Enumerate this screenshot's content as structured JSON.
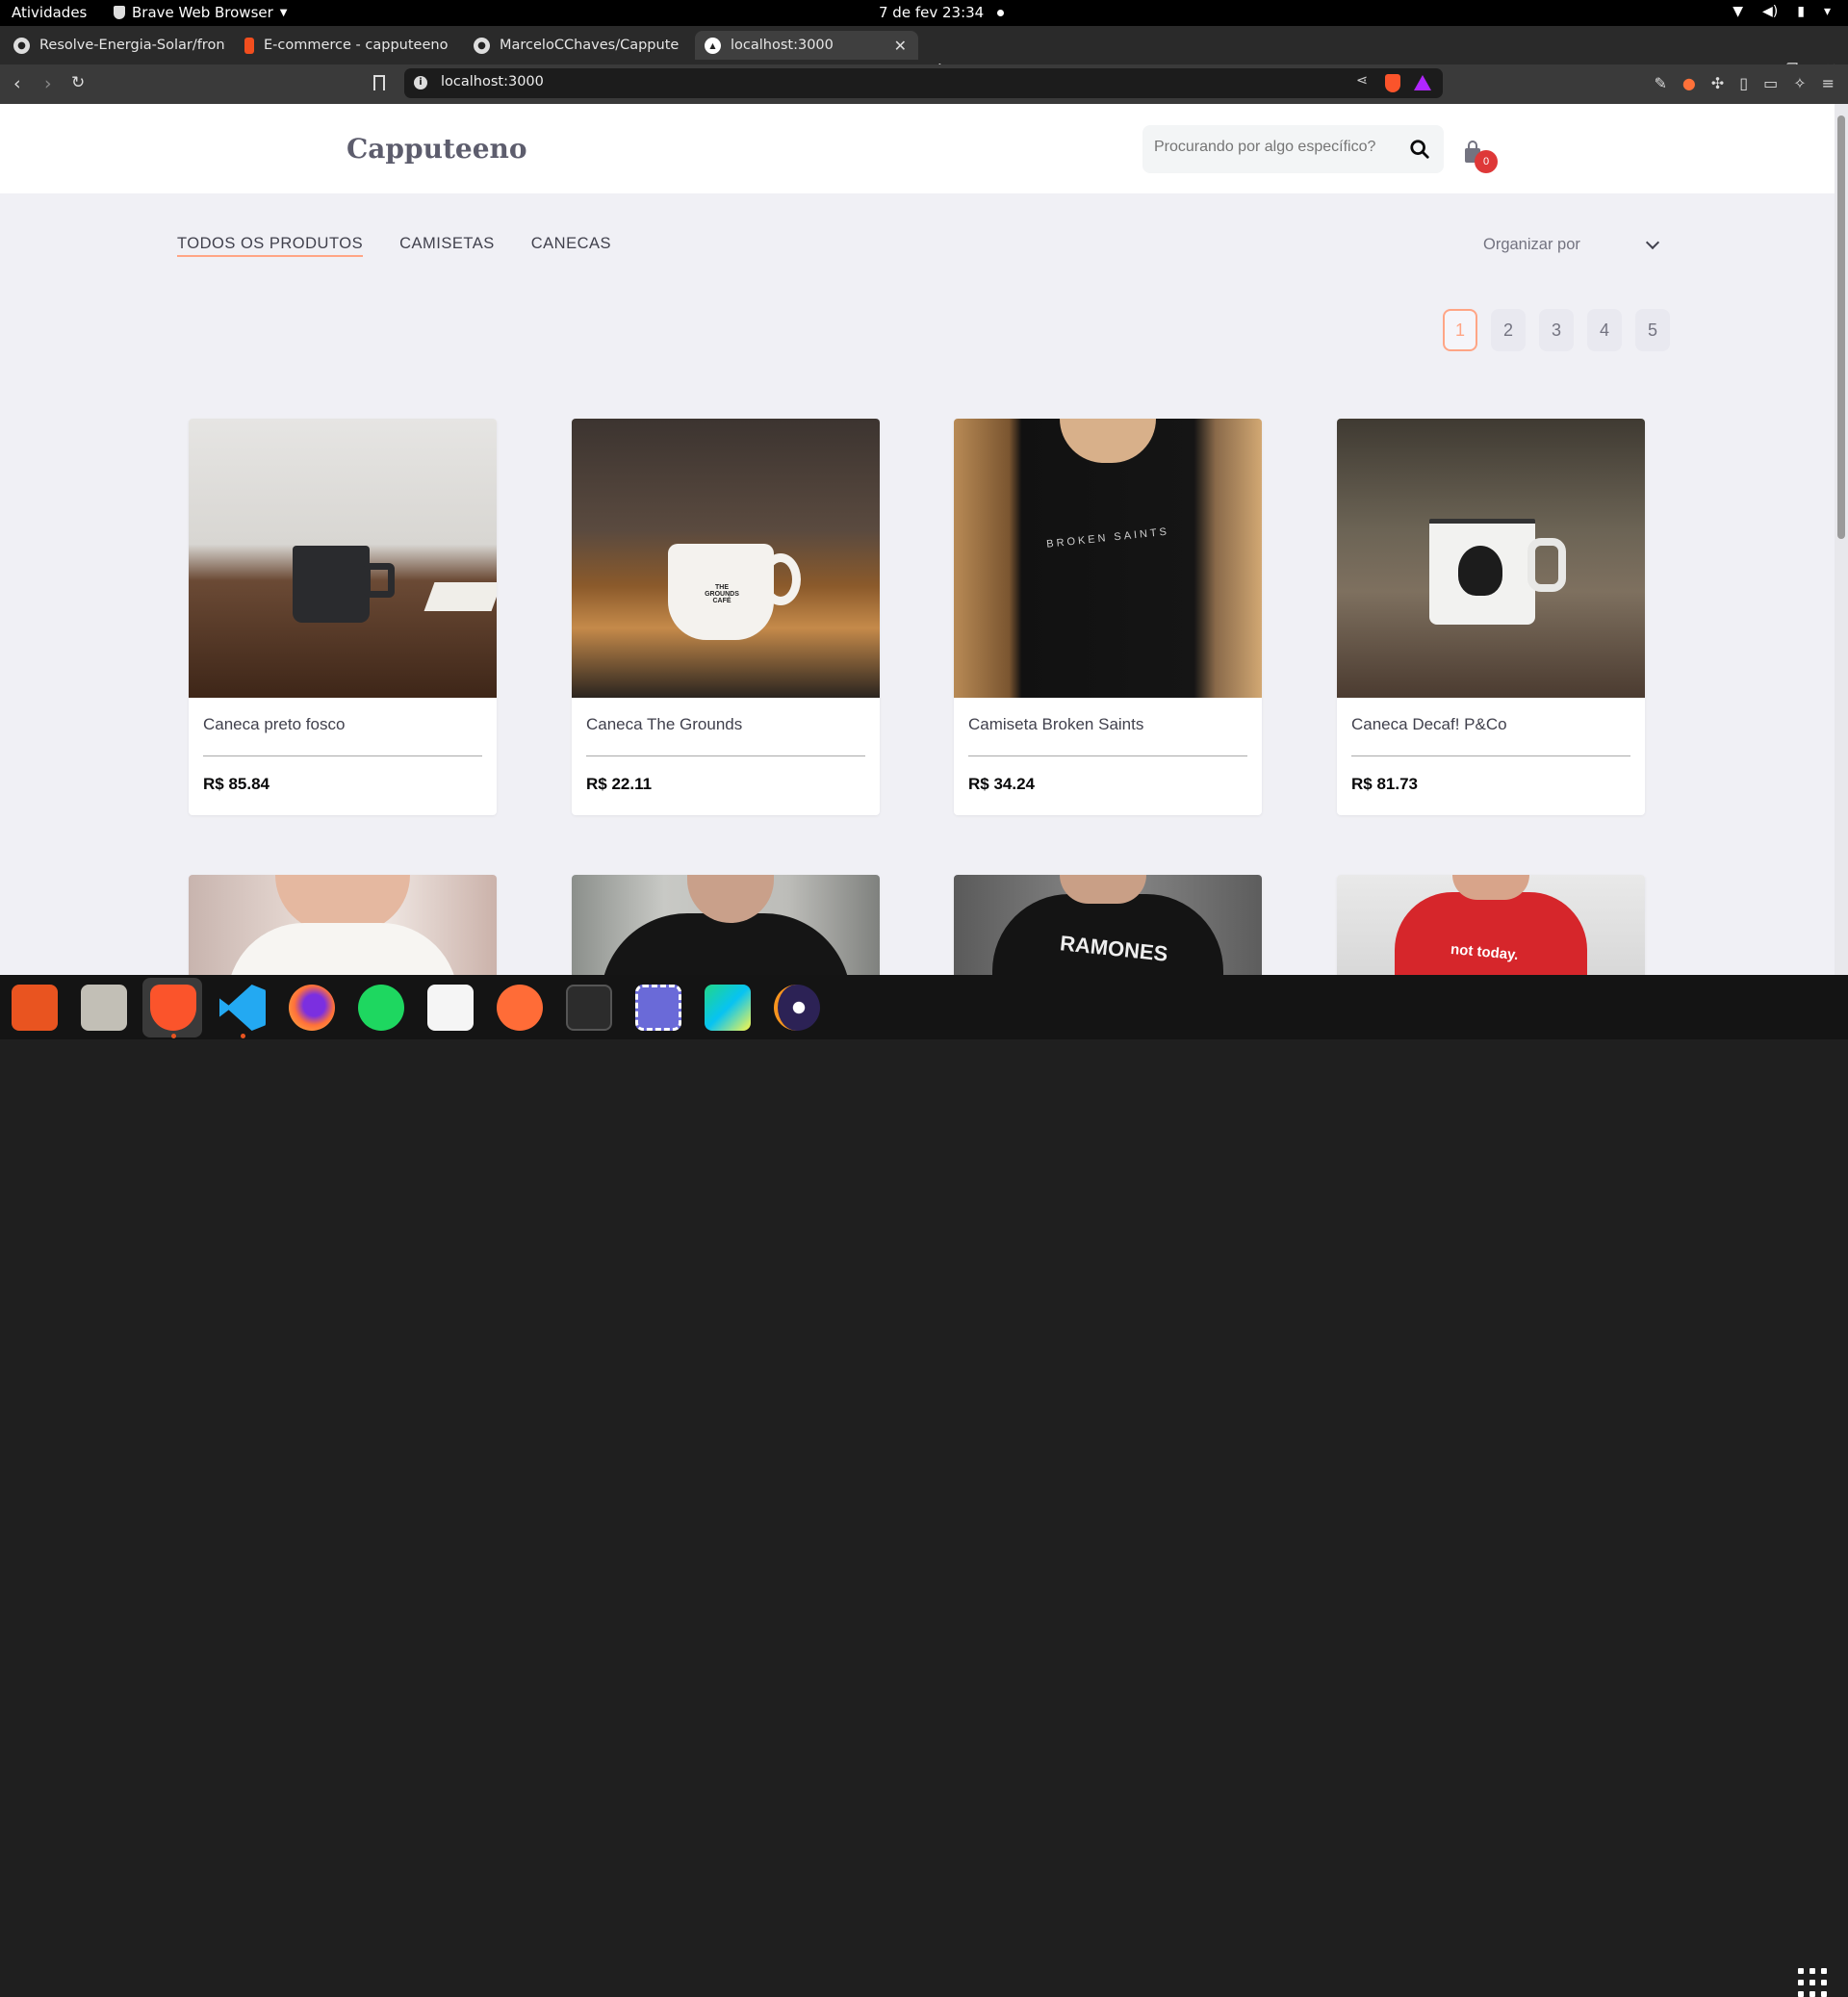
{
  "system": {
    "activities": "Atividades",
    "app_name": "Brave Web Browser",
    "clock": "7 de fev  23:34"
  },
  "tabs": [
    {
      "title": "Resolve-Energia-Solar/front",
      "icon": "github-icon"
    },
    {
      "title": "E-commerce - capputeeno -",
      "icon": "figma-icon"
    },
    {
      "title": "MarceloCChaves/Capputeen",
      "icon": "github-icon"
    },
    {
      "title": "localhost:3000",
      "icon": "vercel-icon",
      "active": true
    }
  ],
  "address": {
    "url": "localhost:3000"
  },
  "site": {
    "logo": "Capputeeno",
    "search_placeholder": "Procurando por algo específico?",
    "cart_count": "0",
    "filters": [
      "TODOS OS PRODUTOS",
      "CAMISETAS",
      "CANECAS"
    ],
    "active_filter": "TODOS OS PRODUTOS",
    "sort_label": "Organizar por",
    "pages": [
      "1",
      "2",
      "3",
      "4",
      "5"
    ],
    "current_page": "1"
  },
  "products": [
    {
      "name": "Caneca preto fosco",
      "price": "R$ 85.84",
      "image": "black-mug-photo"
    },
    {
      "name": "Caneca The Grounds",
      "price": "R$ 22.11",
      "image": "white-mug-the-grounds-photo"
    },
    {
      "name": "Camiseta Broken Saints",
      "price": "R$ 34.24",
      "image": "black-tshirt-broken-saints-photo"
    },
    {
      "name": "Caneca Decaf! P&Co",
      "price": "R$ 81.73",
      "image": "enamel-mug-skull-photo"
    },
    {
      "name": "",
      "price": "",
      "image": "white-tshirt-woman-photo"
    },
    {
      "name": "",
      "price": "",
      "image": "black-tshirt-woman-photo"
    },
    {
      "name": "",
      "price": "",
      "image": "ramones-tshirt-photo"
    },
    {
      "name": "",
      "price": "",
      "image": "red-not-today-tshirt-photo"
    }
  ],
  "dock_apps": [
    "ubuntu-software-icon",
    "files-icon",
    "brave-icon",
    "vscode-icon",
    "firefox-icon",
    "spotify-icon",
    "inkscape-icon",
    "postman-icon",
    "terminal-icon",
    "screenshot-icon",
    "pycharm-icon",
    "eclipse-icon"
  ],
  "colors": {
    "accent": "#ffa585",
    "badge": "#de3838",
    "text": "#41414d",
    "bg": "#f0f0f5"
  }
}
